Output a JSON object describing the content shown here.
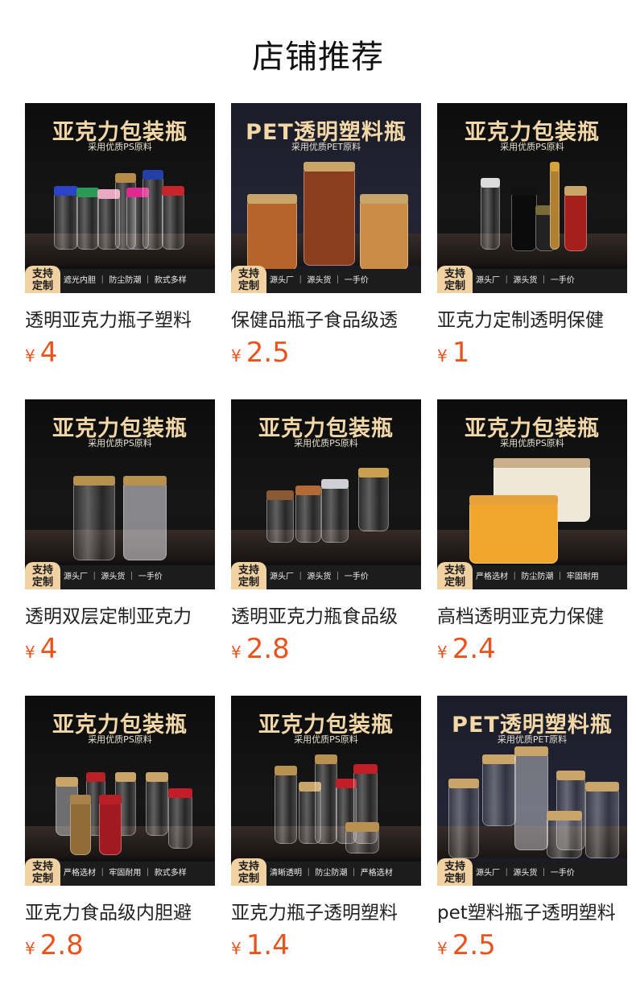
{
  "page": {
    "title": "店铺推荐"
  },
  "colors": {
    "price": "#e7541d",
    "banner_title": "#f2d7a7",
    "badge": "#f0d1a1"
  },
  "products": [
    {
      "banner_title": "亚克力包装瓶",
      "banner_sub": "采用优质PS原料",
      "badge": "支持\n定制",
      "features": "遮光内胆 ｜ 防尘防潮 ｜ 款式多样",
      "name": "透明亚克力瓶子塑料",
      "currency": "¥",
      "price": "4",
      "theme": "dark",
      "scene": "jars-colored"
    },
    {
      "banner_title": "PET透明塑料瓶",
      "banner_sub": "采用优质PET原料",
      "badge": "支持\n定制",
      "features": "源头厂 ｜ 源头货 ｜ 一手价",
      "name": "保健品瓶子食品级透",
      "currency": "¥",
      "price": "2.5",
      "theme": "blue",
      "scene": "jars-food"
    },
    {
      "banner_title": "亚克力包装瓶",
      "banner_sub": "采用优质PS原料",
      "badge": "支持\n定制",
      "features": "源头厂 ｜ 源头货 ｜ 一手价",
      "name": "亚克力定制透明保健",
      "currency": "¥",
      "price": "1",
      "theme": "dark",
      "scene": "bottles-red"
    },
    {
      "banner_title": "亚克力包装瓶",
      "banner_sub": "采用优质PS原料",
      "badge": "支持\n定制",
      "features": "源头厂 ｜ 源头货 ｜ 一手价",
      "name": "透明双层定制亚克力",
      "currency": "¥",
      "price": "4",
      "theme": "dark",
      "scene": "bottles-two"
    },
    {
      "banner_title": "亚克力包装瓶",
      "banner_sub": "采用优质PS原料",
      "badge": "支持\n定制",
      "features": "源头厂 ｜ 源头货 ｜ 一手价",
      "name": "透明亚克力瓶食品级",
      "currency": "¥",
      "price": "2.8",
      "theme": "dark",
      "scene": "jars-small"
    },
    {
      "banner_title": "亚克力包装瓶",
      "banner_sub": "采用优质PS原料",
      "badge": "支持\n定制",
      "features": "严格选材 ｜ 防尘防潮 ｜ 牢固耐用",
      "name": "高档透明亚克力保健",
      "currency": "¥",
      "price": "2.4",
      "theme": "dark",
      "scene": "box-gold"
    },
    {
      "banner_title": "亚克力包装瓶",
      "banner_sub": "采用优质PS原料",
      "badge": "支持\n定制",
      "features": "严格选材 ｜ 牢固耐用 ｜ 款式多样",
      "name": "亚克力食品级内胆避",
      "currency": "¥",
      "price": "2.8",
      "theme": "dark",
      "scene": "jars-red"
    },
    {
      "banner_title": "亚克力包装瓶",
      "banner_sub": "采用优质PS原料",
      "badge": "支持\n定制",
      "features": "清晰透明 ｜ 防尘防潮 ｜ 严格选材",
      "name": "亚克力瓶子透明塑料",
      "currency": "¥",
      "price": "1.4",
      "theme": "dark",
      "scene": "jars-mixed"
    },
    {
      "banner_title": "PET透明塑料瓶",
      "banner_sub": "采用优质PET原料",
      "badge": "支持\n定制",
      "features": "源头厂 ｜ 源头货 ｜ 一手价",
      "name": "pet塑料瓶子透明塑料",
      "currency": "¥",
      "price": "2.5",
      "theme": "blue",
      "scene": "jars-clear"
    }
  ]
}
